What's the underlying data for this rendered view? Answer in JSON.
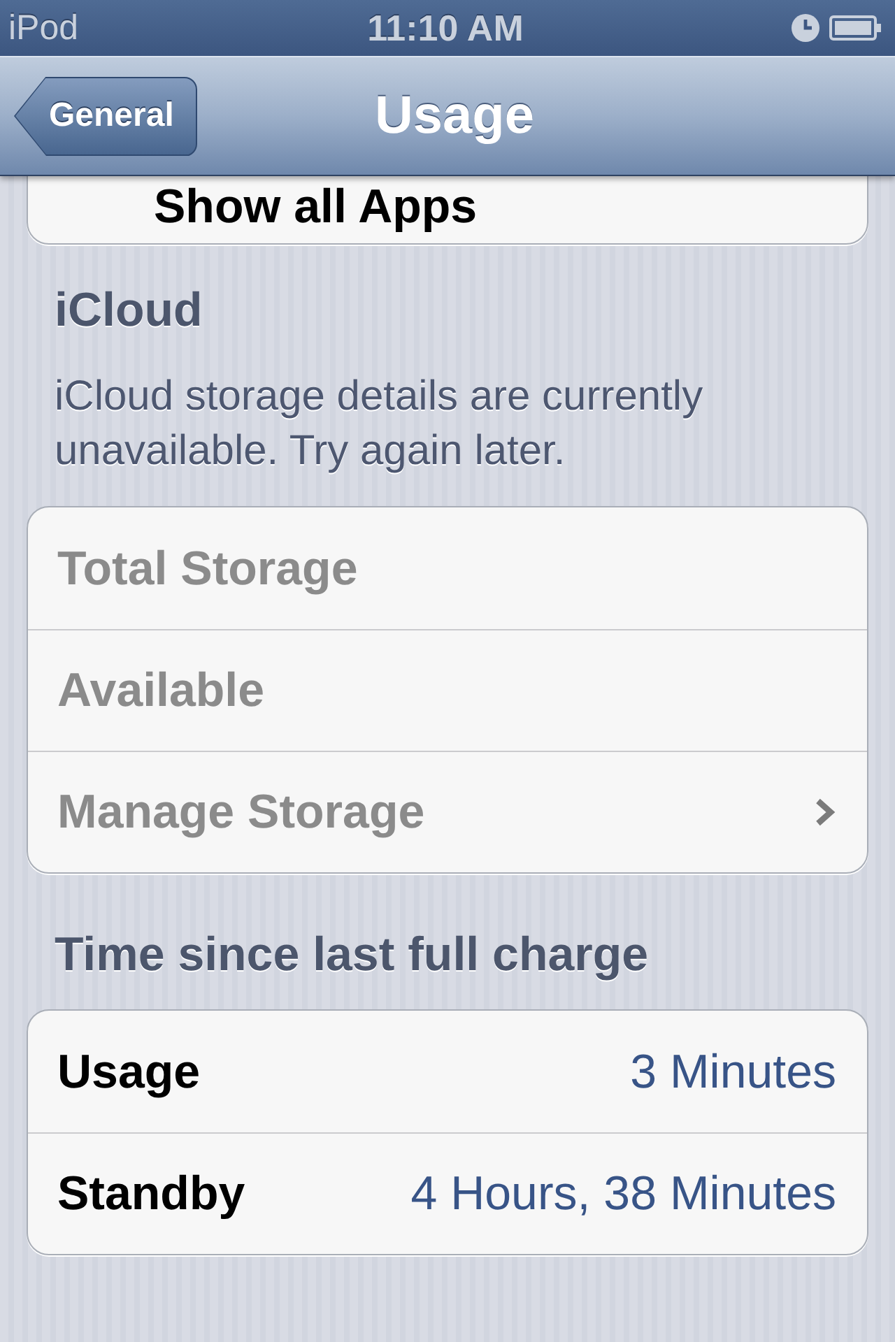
{
  "status_bar": {
    "carrier": "iPod",
    "time": "11:10 AM"
  },
  "nav_bar": {
    "back_button": "General",
    "title": "Usage"
  },
  "sections": [
    {
      "rows": [
        {
          "label": "Show all Apps",
          "kind": "action",
          "disabled": false
        }
      ]
    },
    {
      "title": "iCloud",
      "note": "iCloud storage details are currently unavailable. Try again later.",
      "rows": [
        {
          "label": "Total Storage",
          "kind": "plain",
          "disabled": true
        },
        {
          "label": "Available",
          "kind": "plain",
          "disabled": true
        },
        {
          "label": "Manage Storage",
          "kind": "disclosure",
          "disabled": true
        }
      ]
    },
    {
      "title": "Time since last full charge",
      "rows": [
        {
          "label": "Usage",
          "kind": "value",
          "value": "3 Minutes",
          "disabled": false
        },
        {
          "label": "Standby",
          "kind": "value",
          "value": "4 Hours, 38 Minutes",
          "disabled": false
        }
      ]
    }
  ]
}
